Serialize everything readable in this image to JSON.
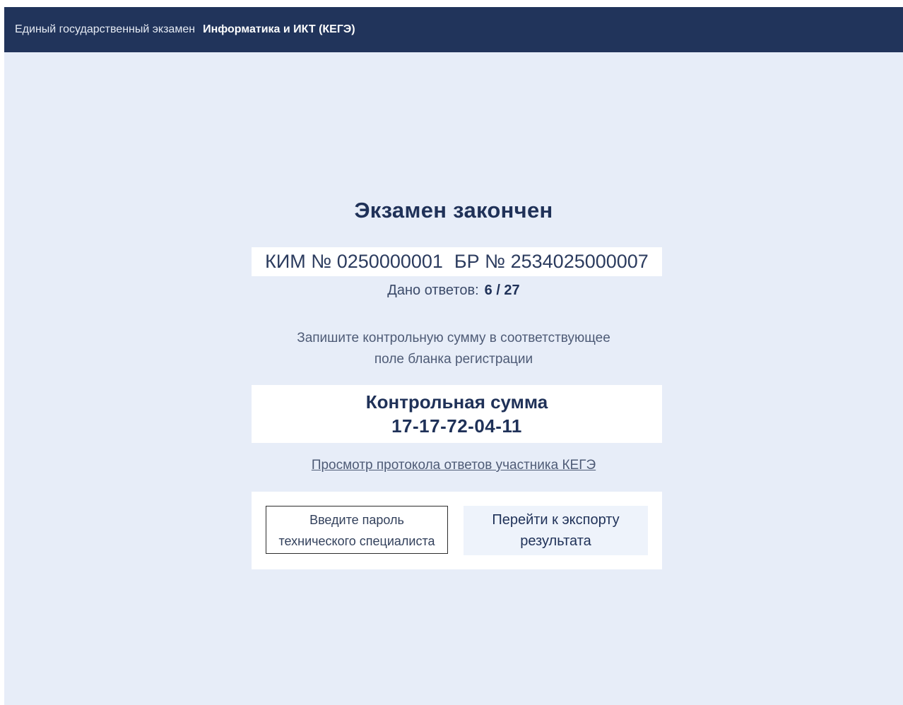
{
  "header": {
    "exam_type": "Единый государственный экзамен",
    "subject": "Информатика и ИКТ (КЕГЭ)"
  },
  "main": {
    "title": "Экзамен закончен",
    "kim_label": "КИМ № 0250000001",
    "br_label": "БР № 2534025000007",
    "answers_label": "Дано ответов:",
    "answers_value": "6 / 27",
    "instruction_line1": "Запишите контрольную сумму в соответствующее",
    "instruction_line2": "поле бланка регистрации",
    "checksum_label": "Контрольная сумма",
    "checksum_value": "17-17-72-04-11",
    "protocol_link": "Просмотр протокола ответов участника КЕГЭ"
  },
  "actions": {
    "password_placeholder_line1": "Введите пароль",
    "password_placeholder_line2": "технического специалиста",
    "export_line1": "Перейти к экспорту",
    "export_line2": "результата"
  },
  "colors": {
    "header_bg": "#21345b",
    "page_bg": "#e7edf8",
    "text_primary": "#1f3158",
    "export_button_bg": "#eef3fb"
  }
}
